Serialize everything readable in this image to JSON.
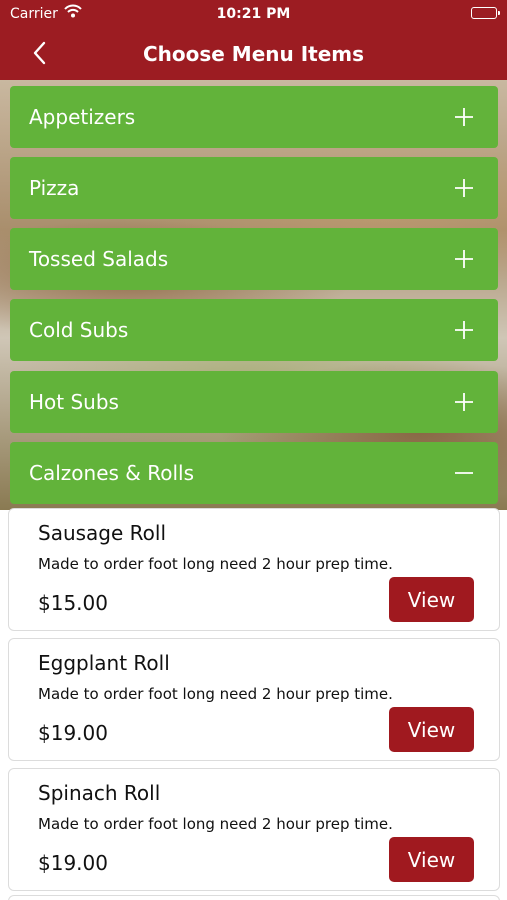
{
  "status_bar": {
    "carrier": "Carrier",
    "time": "10:21 PM"
  },
  "nav": {
    "title": "Choose Menu Items"
  },
  "colors": {
    "brand_red": "#9c1c22",
    "category_green": "#62b33a",
    "view_button": "#a0191f"
  },
  "categories": [
    {
      "label": "Appetizers",
      "toggle": "plus-icon"
    },
    {
      "label": "Pizza",
      "toggle": "plus-icon"
    },
    {
      "label": "Tossed Salads",
      "toggle": "plus-icon"
    },
    {
      "label": "Cold Subs",
      "toggle": "plus-icon"
    },
    {
      "label": "Hot Subs",
      "toggle": "plus-icon"
    },
    {
      "label": "Calzones & Rolls",
      "toggle": "minus-icon"
    }
  ],
  "items": [
    {
      "name": "Sausage Roll",
      "description": "Made to order foot long need 2 hour prep time.",
      "price": "$15.00",
      "button": "View"
    },
    {
      "name": "Eggplant Roll",
      "description": "Made to order foot long need 2 hour prep time.",
      "price": "$19.00",
      "button": "View"
    },
    {
      "name": "Spinach Roll",
      "description": "Made to order foot long need 2 hour prep time.",
      "price": "$19.00",
      "button": "View"
    }
  ]
}
